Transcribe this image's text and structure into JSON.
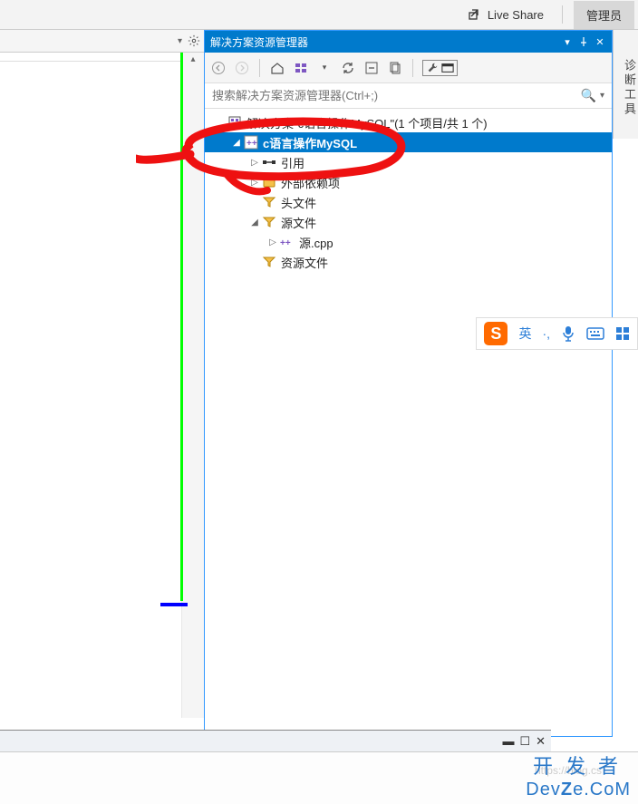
{
  "topbar": {
    "live_share": "Live Share",
    "admin": "管理员"
  },
  "panel": {
    "title": "解决方案资源管理器",
    "search_placeholder": "搜索解决方案资源管理器(Ctrl+;)"
  },
  "tree": {
    "solution": "解决方案\"c语言操作MySQL\"(1 个项目/共 1 个)",
    "project": "c语言操作MySQL",
    "references": "引用",
    "external_deps": "外部依赖项",
    "headers": "头文件",
    "sources": "源文件",
    "source_file": "源.cpp",
    "resources": "资源文件"
  },
  "right_tab": "诊断工具",
  "ime": {
    "logo": "S",
    "lang": "英",
    "punct": "·,"
  },
  "brand": {
    "cn": "开发者",
    "en_pre": "Dev",
    "en_mid": "Z",
    "en_suf": "e.CoM"
  },
  "watermark": "https://blog.cs"
}
